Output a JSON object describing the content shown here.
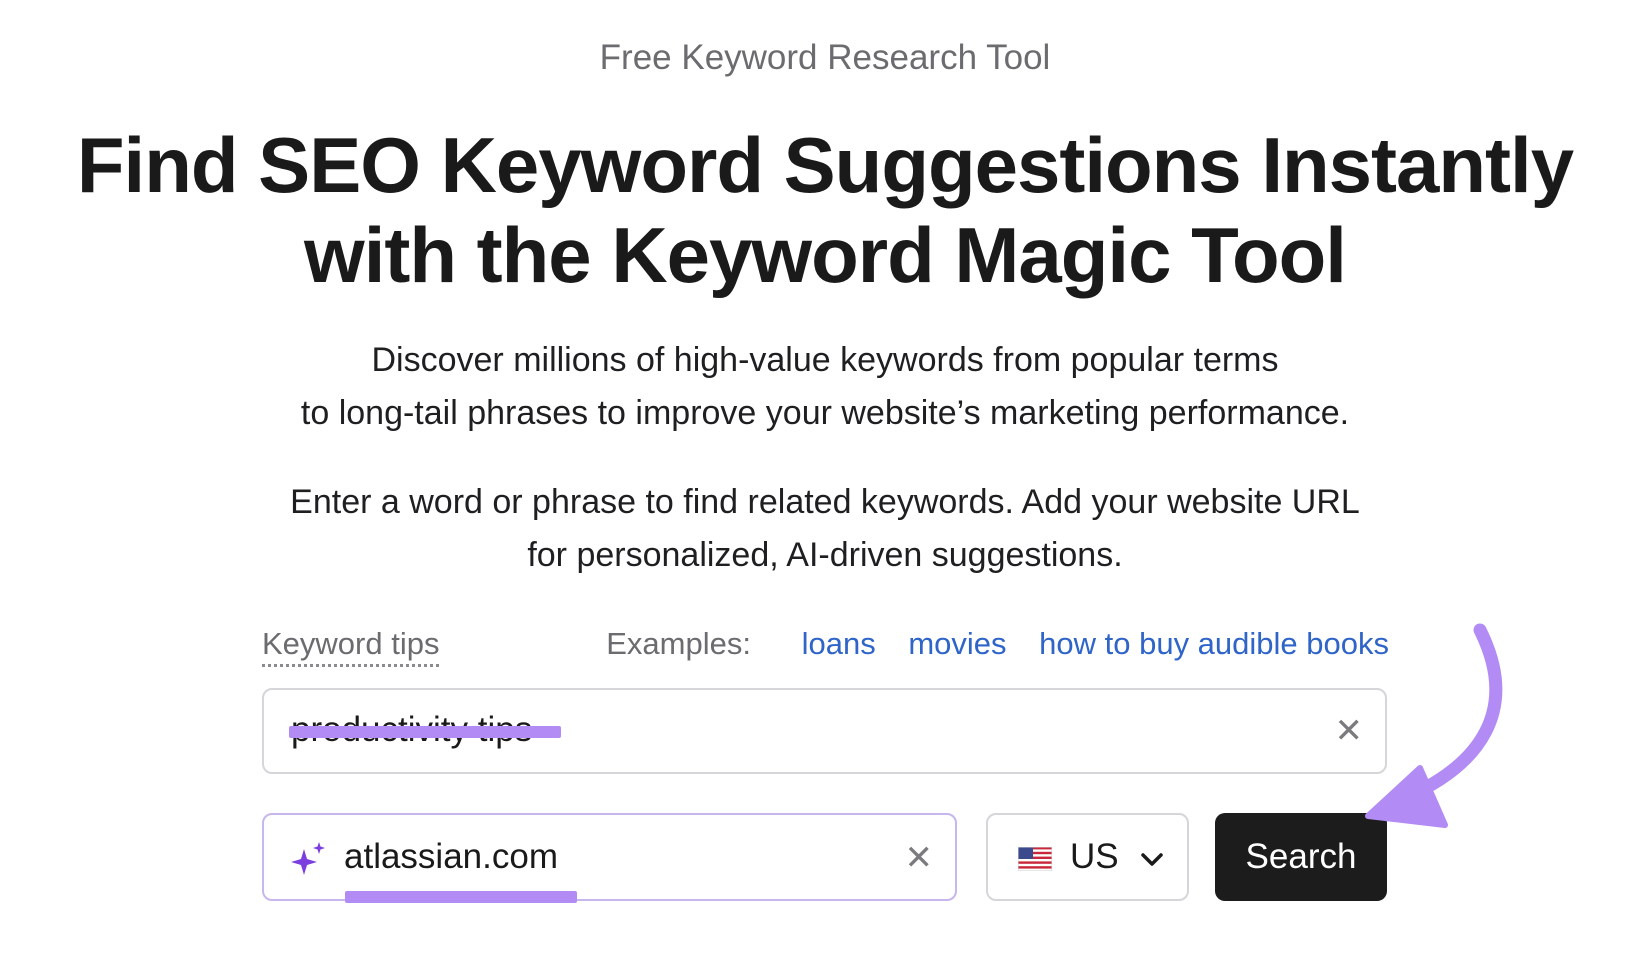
{
  "header": {
    "eyebrow": "Free Keyword Research Tool",
    "headline_line1": "Find SEO Keyword Suggestions Instantly",
    "headline_line2": "with the Keyword Magic Tool"
  },
  "description": {
    "line1": "Discover millions of high-value keywords from popular terms",
    "line2": "to long-tail phrases to improve your website’s marketing performance."
  },
  "instructions": {
    "line1": "Enter a word or phrase to find related keywords. Add your website URL",
    "line2": "for personalized, AI-driven suggestions."
  },
  "tips": {
    "keyword_tips_label": "Keyword tips",
    "examples_label": "Examples:",
    "examples": [
      "loans",
      "movies",
      "how to buy audible books"
    ]
  },
  "keyword_input": {
    "value": "productivity tips",
    "clear_icon": "close-icon"
  },
  "url_input": {
    "value": "atlassian.com",
    "leading_icon": "sparkle-icon",
    "clear_icon": "close-icon"
  },
  "country_select": {
    "selected": "US",
    "flag_icon": "us-flag-icon",
    "chevron_icon": "chevron-down-icon"
  },
  "search_button": {
    "label": "Search"
  },
  "colors": {
    "highlight": "#b28bf4",
    "link": "#2f64c8",
    "button_bg": "#1c1c1c",
    "arrow": "#b28bf4",
    "sparkle": "#7d3ee0"
  }
}
